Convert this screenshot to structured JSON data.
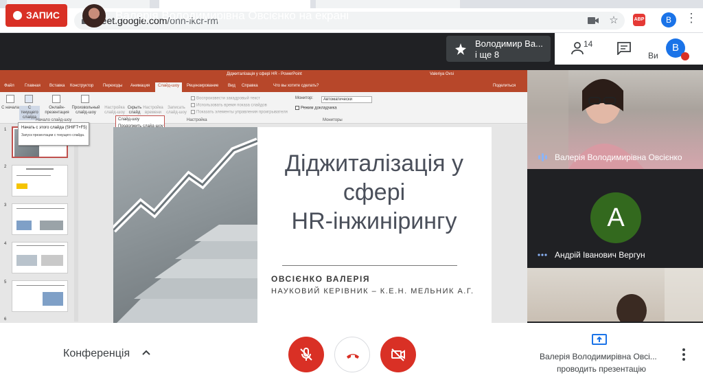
{
  "browser": {
    "url_host": "meet.google.com",
    "url_path": "/onn-ikcr-rm",
    "abp_label": "ABP",
    "profile_initial": "B"
  },
  "meet": {
    "record_label": "ЗАПИС",
    "presenting_title": "Валерія Володимирівна Овсієнко на екрані",
    "chip_line1": "Володимир Ва...",
    "chip_line2": "і ще 8",
    "people_count": "14",
    "me_label": "Ви",
    "me_initial": "B",
    "conference_label": "Конференція",
    "presenter_name": "Валерія Володимирівна Овсі...",
    "presenter_status": "проводить презентацію",
    "colors": {
      "record": "#d93025",
      "avatar_a": "#33691e",
      "profile": "#1a73e8"
    }
  },
  "participants": [
    {
      "name": "Валерія Володимирівна Овсієнко"
    },
    {
      "name": "Андрій Іванович Вергун",
      "initial": "A"
    }
  ],
  "ppt": {
    "window_title": "Діджиталізація у сфері HR - PowerPoint",
    "user": "Valeriya Ovsi",
    "tabs": [
      "Файл",
      "Главная",
      "Вставка",
      "Конструктор",
      "Переходы",
      "Анимация",
      "Слайд-шоу",
      "Рецензирование",
      "Вид",
      "Справка",
      "Что вы хотите сделать?",
      "Поделиться"
    ],
    "ribbon": {
      "from_start": "С начала",
      "from_current": "С текущего слайда",
      "online": "Онлайн-презентация",
      "custom": "Произвольный слайд-шоу",
      "setup": "Настройка слайд-шоу",
      "hide": "Скрыть слайд",
      "timing": "Настройка времени",
      "record": "Записать слайд-шоу",
      "group_start": "Начало слайд-шоу",
      "group_setup": "Настройка",
      "group_monitors": "Мониторы",
      "chk_narration": "Воспроизвести закадровый текст",
      "chk_timings": "Использовать время показа слайдов",
      "chk_media": "Показать элементы управления проигрывателя",
      "monitor_label": "Монитор:",
      "monitor_value": "Автоматически",
      "presenter_view": "Режим докладчика",
      "popup_1": "Слайд-шоу",
      "popup_2": "Продолжить слайд-шоу"
    },
    "tooltip_title": "Начать с этого слайда (SHIFT+F5)",
    "tooltip_body": "Запуск презентации с текущего слайда.",
    "slide_numbers": [
      "1",
      "2",
      "3",
      "4",
      "5",
      "6"
    ]
  },
  "slide": {
    "title_line1": "Діджиталізація у",
    "title_line2": "сфері",
    "title_line3": "HR-інжинірингу",
    "author": "ОВСІЄНКО ВАЛЕРІЯ",
    "supervisor": "НАУКОВИЙ КЕРІВНИК – К.Е.Н. МЕЛЬНИК А.Г."
  }
}
